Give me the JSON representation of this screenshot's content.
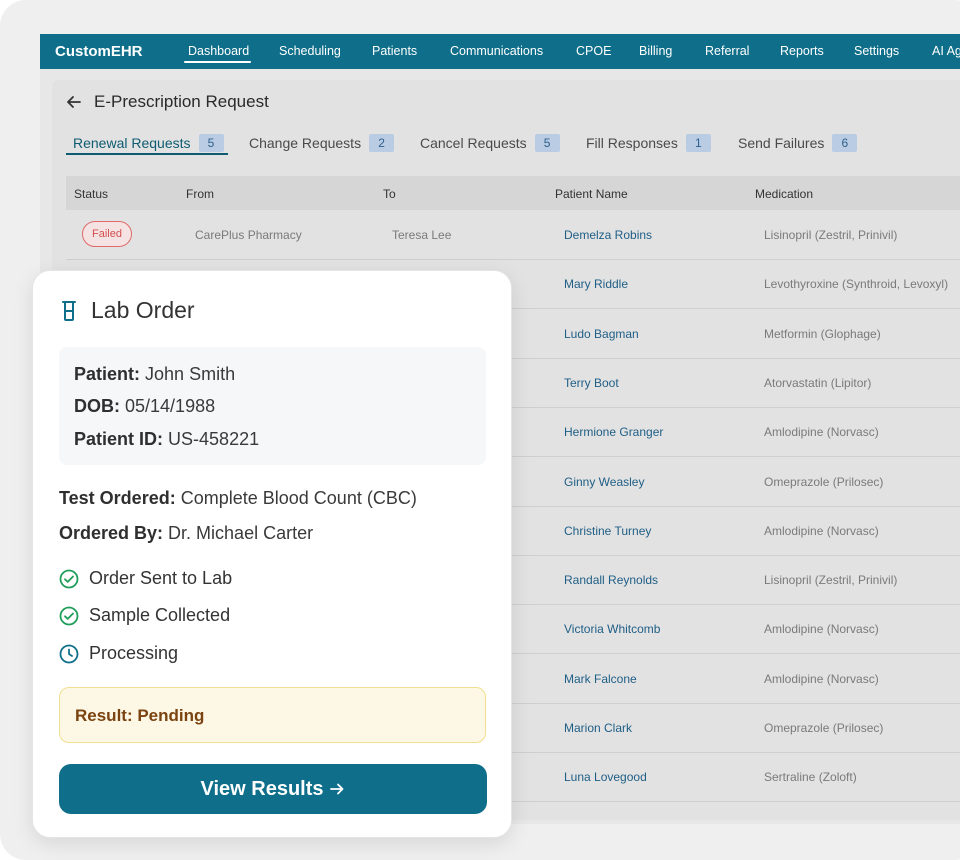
{
  "app": {
    "brand": "CustomEHR",
    "nav": [
      {
        "label": "Dashboard",
        "active": true
      },
      {
        "label": "Scheduling"
      },
      {
        "label": "Patients"
      },
      {
        "label": "Communications"
      },
      {
        "label": "CPOE"
      },
      {
        "label": "Billing"
      },
      {
        "label": "Referral"
      },
      {
        "label": "Reports"
      },
      {
        "label": "Settings"
      },
      {
        "label": "AI Ag"
      }
    ]
  },
  "page": {
    "title": "E-Prescription Request",
    "tabs": [
      {
        "label": "Renewal Requests",
        "count": "5",
        "active": true
      },
      {
        "label": "Change Requests",
        "count": "2"
      },
      {
        "label": "Cancel Requests",
        "count": "5"
      },
      {
        "label": "Fill Responses",
        "count": "1"
      },
      {
        "label": "Send Failures",
        "count": "6"
      }
    ]
  },
  "table": {
    "headers": [
      "Status",
      "From",
      "To",
      "Patient Name",
      "Medication"
    ],
    "rows": [
      {
        "status": "Failed",
        "from": "CarePlus Pharmacy",
        "to": "Teresa Lee",
        "patient": "Demelza Robins",
        "medication": "Lisinopril (Zestril, Prinivil)"
      },
      {
        "status": "",
        "from": "",
        "to": "",
        "patient": "Mary Riddle",
        "medication": "Levothyroxine (Synthroid, Levoxyl)"
      },
      {
        "status": "",
        "from": "",
        "to": "",
        "patient": "Ludo Bagman",
        "medication": "Metformin (Glophage)"
      },
      {
        "status": "",
        "from": "",
        "to": "",
        "patient": "Terry Boot",
        "medication": "Atorvastatin (Lipitor)"
      },
      {
        "status": "",
        "from": "",
        "to": "",
        "patient": "Hermione Granger",
        "medication": "Amlodipine (Norvasc)"
      },
      {
        "status": "",
        "from": "",
        "to": "",
        "patient": "Ginny Weasley",
        "medication": "Omeprazole (Prilosec)"
      },
      {
        "status": "",
        "from": "",
        "to": "",
        "patient": "Christine Turney",
        "medication": "Amlodipine (Norvasc)"
      },
      {
        "status": "",
        "from": "",
        "to": "",
        "patient": "Randall Reynolds",
        "medication": "Lisinopril (Zestril, Prinivil)"
      },
      {
        "status": "",
        "from": "",
        "to": "",
        "patient": "Victoria Whitcomb",
        "medication": "Amlodipine (Norvasc)"
      },
      {
        "status": "",
        "from": "",
        "to": "",
        "patient": "Mark Falcone",
        "medication": "Amlodipine (Norvasc)"
      },
      {
        "status": "",
        "from": "",
        "to": "",
        "patient": "Marion Clark",
        "medication": "Omeprazole (Prilosec)"
      },
      {
        "status": "",
        "from": "",
        "to": "",
        "patient": "Luna Lovegood",
        "medication": "Sertraline (Zoloft)"
      }
    ]
  },
  "lab_order": {
    "title": "Lab Order",
    "icon": "beaker-icon",
    "patient_label": "Patient:",
    "patient_value": "John Smith",
    "dob_label": "DOB:",
    "dob_value": "05/14/1988",
    "patient_id_label": "Patient ID:",
    "patient_id_value": "US-458221",
    "test_label": "Test Ordered:",
    "test_value": "Complete Blood Count (CBC)",
    "ordered_by_label": "Ordered By:",
    "ordered_by_value": "Dr. Michael Carter",
    "steps": [
      {
        "label": "Order Sent to Lab",
        "icon": "check-circle-icon"
      },
      {
        "label": "Sample Collected",
        "icon": "check-circle-icon"
      },
      {
        "label": "Processing",
        "icon": "clock-icon"
      }
    ],
    "result": "Result: Pending",
    "button": "View Results",
    "colors": {
      "primary": "#0f6f8a",
      "success": "#1e9e5a",
      "warning_bg": "#fdf8e6",
      "warning_text": "#7a4310"
    }
  }
}
